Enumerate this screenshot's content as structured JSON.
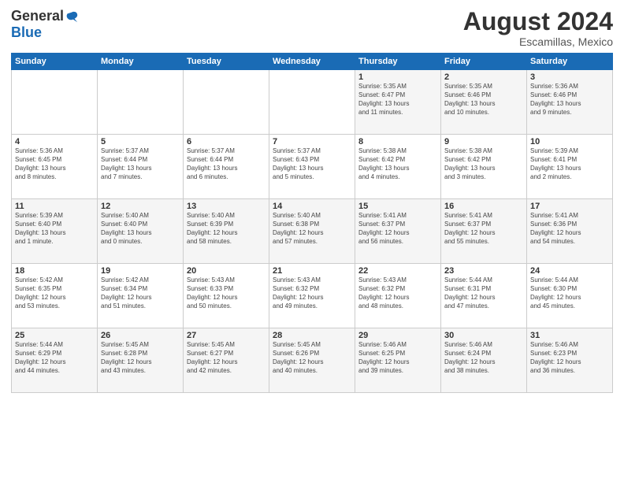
{
  "header": {
    "logo_general": "General",
    "logo_blue": "Blue",
    "month_title": "August 2024",
    "location": "Escamillas, Mexico"
  },
  "weekdays": [
    "Sunday",
    "Monday",
    "Tuesday",
    "Wednesday",
    "Thursday",
    "Friday",
    "Saturday"
  ],
  "weeks": [
    [
      {
        "day": "",
        "info": ""
      },
      {
        "day": "",
        "info": ""
      },
      {
        "day": "",
        "info": ""
      },
      {
        "day": "",
        "info": ""
      },
      {
        "day": "1",
        "info": "Sunrise: 5:35 AM\nSunset: 6:47 PM\nDaylight: 13 hours\nand 11 minutes."
      },
      {
        "day": "2",
        "info": "Sunrise: 5:35 AM\nSunset: 6:46 PM\nDaylight: 13 hours\nand 10 minutes."
      },
      {
        "day": "3",
        "info": "Sunrise: 5:36 AM\nSunset: 6:46 PM\nDaylight: 13 hours\nand 9 minutes."
      }
    ],
    [
      {
        "day": "4",
        "info": "Sunrise: 5:36 AM\nSunset: 6:45 PM\nDaylight: 13 hours\nand 8 minutes."
      },
      {
        "day": "5",
        "info": "Sunrise: 5:37 AM\nSunset: 6:44 PM\nDaylight: 13 hours\nand 7 minutes."
      },
      {
        "day": "6",
        "info": "Sunrise: 5:37 AM\nSunset: 6:44 PM\nDaylight: 13 hours\nand 6 minutes."
      },
      {
        "day": "7",
        "info": "Sunrise: 5:37 AM\nSunset: 6:43 PM\nDaylight: 13 hours\nand 5 minutes."
      },
      {
        "day": "8",
        "info": "Sunrise: 5:38 AM\nSunset: 6:42 PM\nDaylight: 13 hours\nand 4 minutes."
      },
      {
        "day": "9",
        "info": "Sunrise: 5:38 AM\nSunset: 6:42 PM\nDaylight: 13 hours\nand 3 minutes."
      },
      {
        "day": "10",
        "info": "Sunrise: 5:39 AM\nSunset: 6:41 PM\nDaylight: 13 hours\nand 2 minutes."
      }
    ],
    [
      {
        "day": "11",
        "info": "Sunrise: 5:39 AM\nSunset: 6:40 PM\nDaylight: 13 hours\nand 1 minute."
      },
      {
        "day": "12",
        "info": "Sunrise: 5:40 AM\nSunset: 6:40 PM\nDaylight: 13 hours\nand 0 minutes."
      },
      {
        "day": "13",
        "info": "Sunrise: 5:40 AM\nSunset: 6:39 PM\nDaylight: 12 hours\nand 58 minutes."
      },
      {
        "day": "14",
        "info": "Sunrise: 5:40 AM\nSunset: 6:38 PM\nDaylight: 12 hours\nand 57 minutes."
      },
      {
        "day": "15",
        "info": "Sunrise: 5:41 AM\nSunset: 6:37 PM\nDaylight: 12 hours\nand 56 minutes."
      },
      {
        "day": "16",
        "info": "Sunrise: 5:41 AM\nSunset: 6:37 PM\nDaylight: 12 hours\nand 55 minutes."
      },
      {
        "day": "17",
        "info": "Sunrise: 5:41 AM\nSunset: 6:36 PM\nDaylight: 12 hours\nand 54 minutes."
      }
    ],
    [
      {
        "day": "18",
        "info": "Sunrise: 5:42 AM\nSunset: 6:35 PM\nDaylight: 12 hours\nand 53 minutes."
      },
      {
        "day": "19",
        "info": "Sunrise: 5:42 AM\nSunset: 6:34 PM\nDaylight: 12 hours\nand 51 minutes."
      },
      {
        "day": "20",
        "info": "Sunrise: 5:43 AM\nSunset: 6:33 PM\nDaylight: 12 hours\nand 50 minutes."
      },
      {
        "day": "21",
        "info": "Sunrise: 5:43 AM\nSunset: 6:32 PM\nDaylight: 12 hours\nand 49 minutes."
      },
      {
        "day": "22",
        "info": "Sunrise: 5:43 AM\nSunset: 6:32 PM\nDaylight: 12 hours\nand 48 minutes."
      },
      {
        "day": "23",
        "info": "Sunrise: 5:44 AM\nSunset: 6:31 PM\nDaylight: 12 hours\nand 47 minutes."
      },
      {
        "day": "24",
        "info": "Sunrise: 5:44 AM\nSunset: 6:30 PM\nDaylight: 12 hours\nand 45 minutes."
      }
    ],
    [
      {
        "day": "25",
        "info": "Sunrise: 5:44 AM\nSunset: 6:29 PM\nDaylight: 12 hours\nand 44 minutes."
      },
      {
        "day": "26",
        "info": "Sunrise: 5:45 AM\nSunset: 6:28 PM\nDaylight: 12 hours\nand 43 minutes."
      },
      {
        "day": "27",
        "info": "Sunrise: 5:45 AM\nSunset: 6:27 PM\nDaylight: 12 hours\nand 42 minutes."
      },
      {
        "day": "28",
        "info": "Sunrise: 5:45 AM\nSunset: 6:26 PM\nDaylight: 12 hours\nand 40 minutes."
      },
      {
        "day": "29",
        "info": "Sunrise: 5:46 AM\nSunset: 6:25 PM\nDaylight: 12 hours\nand 39 minutes."
      },
      {
        "day": "30",
        "info": "Sunrise: 5:46 AM\nSunset: 6:24 PM\nDaylight: 12 hours\nand 38 minutes."
      },
      {
        "day": "31",
        "info": "Sunrise: 5:46 AM\nSunset: 6:23 PM\nDaylight: 12 hours\nand 36 minutes."
      }
    ]
  ]
}
